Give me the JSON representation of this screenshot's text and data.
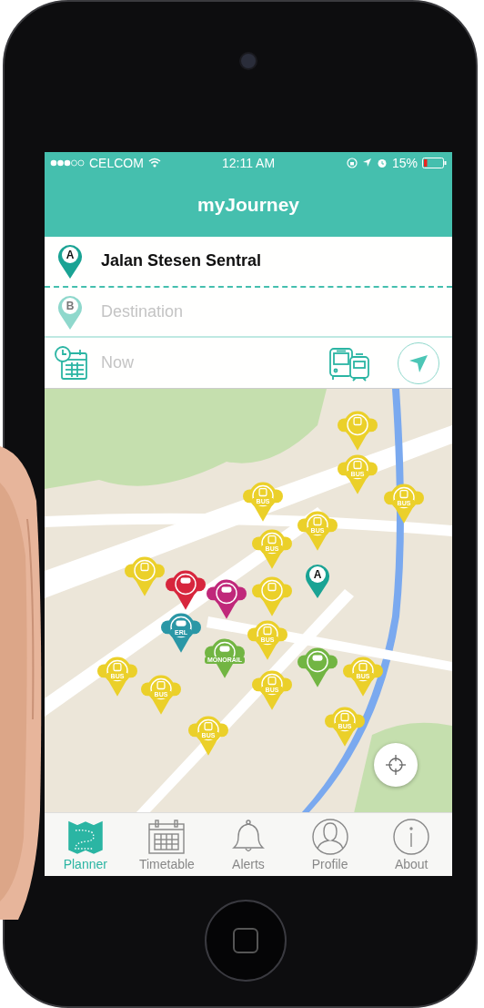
{
  "status_bar": {
    "carrier": "CELCOM",
    "time": "12:11 AM",
    "battery": "15%"
  },
  "title": "myJourney",
  "origin": {
    "pin": "A",
    "value": "Jalan Stesen Sentral"
  },
  "destination": {
    "pin": "B",
    "placeholder": "Destination"
  },
  "time": {
    "placeholder": "Now"
  },
  "map": {
    "markers": [
      {
        "kind": "bus",
        "color": "#ebd02a"
      },
      {
        "kind": "bus",
        "color": "#ebd02a",
        "label": "BUS"
      },
      {
        "kind": "bus",
        "color": "#ebd02a",
        "label": "BUS"
      },
      {
        "kind": "bus",
        "color": "#ebd02a",
        "label": "BUS"
      },
      {
        "kind": "bus",
        "color": "#ebd02a",
        "label": "BUS"
      },
      {
        "kind": "bus",
        "color": "#ebd02a",
        "label": "BUS"
      },
      {
        "kind": "bus",
        "color": "#ebd02a"
      },
      {
        "kind": "train",
        "color": "#d7263d"
      },
      {
        "kind": "train",
        "color": "#c0287a"
      },
      {
        "kind": "train",
        "color": "#2a97a6",
        "label": "ERL"
      },
      {
        "kind": "bus",
        "color": "#ebd02a"
      },
      {
        "kind": "origin",
        "color": "#1aa394",
        "label": "A"
      },
      {
        "kind": "bus",
        "color": "#ebd02a",
        "label": "BUS"
      },
      {
        "kind": "train",
        "color": "#72b543",
        "label": "MONORAIL"
      },
      {
        "kind": "bus",
        "color": "#ebd02a",
        "label": "BUS"
      },
      {
        "kind": "bus",
        "color": "#ebd02a",
        "label": "BUS"
      },
      {
        "kind": "bus",
        "color": "#ebd02a",
        "label": "BUS"
      },
      {
        "kind": "train",
        "color": "#72b543"
      },
      {
        "kind": "bus",
        "color": "#ebd02a",
        "label": "BUS"
      },
      {
        "kind": "bus",
        "color": "#ebd02a",
        "label": "BUS"
      },
      {
        "kind": "bus",
        "color": "#ebd02a",
        "label": "BUS"
      }
    ]
  },
  "tabs": [
    {
      "label": "Planner",
      "selected": true
    },
    {
      "label": "Timetable",
      "selected": false
    },
    {
      "label": "Alerts",
      "selected": false
    },
    {
      "label": "Profile",
      "selected": false
    },
    {
      "label": "About",
      "selected": false
    }
  ]
}
